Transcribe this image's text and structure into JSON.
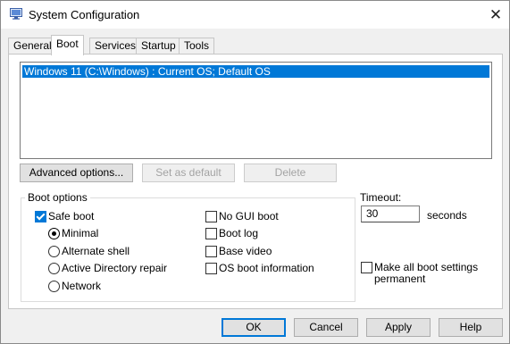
{
  "window": {
    "title": "System Configuration"
  },
  "tabs": [
    {
      "label": "General"
    },
    {
      "label": "Boot"
    },
    {
      "label": "Services"
    },
    {
      "label": "Startup"
    },
    {
      "label": "Tools"
    }
  ],
  "boot_list": {
    "items": [
      "Windows 11 (C:\\Windows) : Current OS; Default OS"
    ],
    "selected_index": 0
  },
  "list_buttons": {
    "advanced": "Advanced options...",
    "set_default": "Set as default",
    "delete": "Delete"
  },
  "boot_options": {
    "title": "Boot options",
    "safe_boot": {
      "label": "Safe boot",
      "checked": true
    },
    "radios": [
      {
        "label": "Minimal",
        "checked": true
      },
      {
        "label": "Alternate shell",
        "checked": false
      },
      {
        "label": "Active Directory repair",
        "checked": false
      },
      {
        "label": "Network",
        "checked": false
      }
    ],
    "right_checks": [
      {
        "label": "No GUI boot",
        "checked": false
      },
      {
        "label": "Boot log",
        "checked": false
      },
      {
        "label": "Base video",
        "checked": false
      },
      {
        "label": "OS boot information",
        "checked": false
      }
    ]
  },
  "timeout": {
    "label": "Timeout:",
    "value": "30",
    "unit": "seconds"
  },
  "make_permanent": {
    "line1": "Make all boot settings",
    "line2": "permanent",
    "checked": false
  },
  "footer": {
    "ok": "OK",
    "cancel": "Cancel",
    "apply": "Apply",
    "help": "Help"
  },
  "colors": {
    "accent": "#0078d7",
    "selection_bg": "#0078d7"
  },
  "icons": {
    "app": "msconfig-app-icon",
    "close": "close-icon"
  }
}
